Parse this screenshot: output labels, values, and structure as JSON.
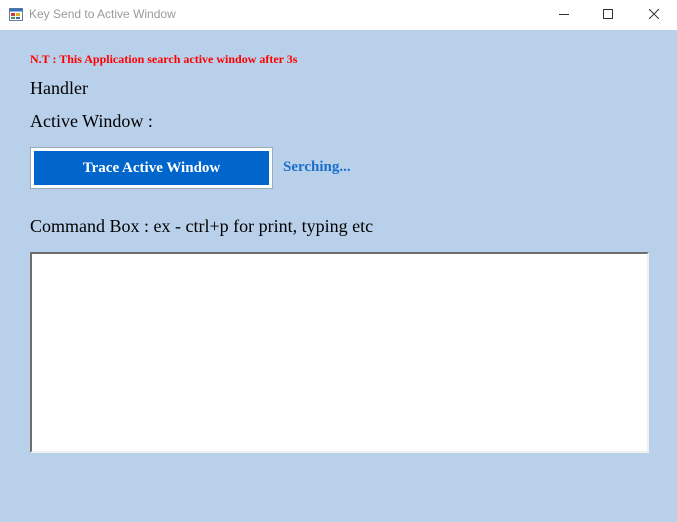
{
  "window": {
    "title": "Key Send to Active Window",
    "icon": "app-window-icon",
    "controls": {
      "minimize_icon": "minimize-icon",
      "maximize_icon": "maximize-icon",
      "close_icon": "close-icon"
    }
  },
  "main": {
    "note": "N.T : This Application search active window after 3s",
    "handler_label": "Handler",
    "active_window_label": "Active Window :",
    "trace_button_label": "Trace Active Window",
    "status_text": "Serching...",
    "command_label": "Command Box : ex - ctrl+p for print, typing etc",
    "command_value": ""
  },
  "colors": {
    "client_background": "#b9d0ea",
    "note_color": "#ff0000",
    "button_background": "#0066cc",
    "status_color": "#1a6fcc"
  }
}
